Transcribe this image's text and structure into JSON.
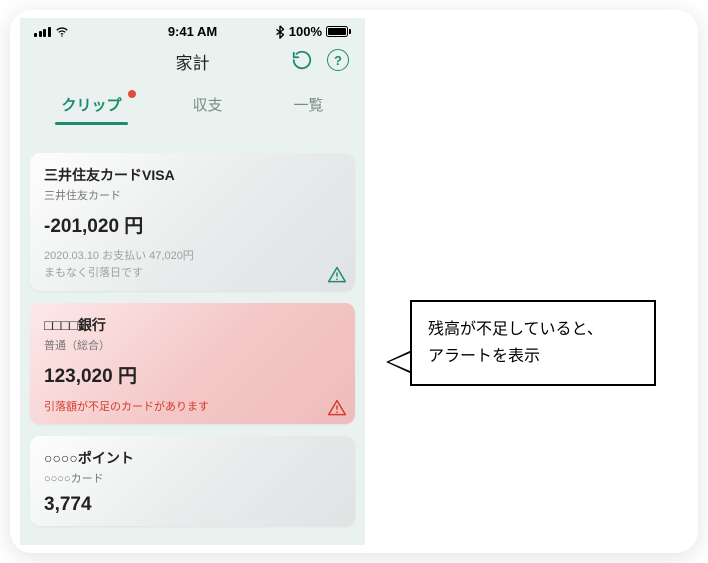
{
  "statusbar": {
    "time": "9:41 AM",
    "bluetooth_icon": "bluetooth",
    "battery_pct": "100%"
  },
  "header": {
    "title": "家計",
    "refresh_icon": "refresh",
    "help_icon": "help",
    "help_glyph": "?"
  },
  "tabs": [
    {
      "label": "クリップ",
      "active": true,
      "has_dot": true
    },
    {
      "label": "収支",
      "active": false,
      "has_dot": false
    },
    {
      "label": "一覧",
      "active": false,
      "has_dot": false
    }
  ],
  "cards": [
    {
      "title": "三井住友カードVISA",
      "subtitle": "三井住友カード",
      "amount": "-201,020 円",
      "note_line1": "2020.03.10 お支払い 47,020円",
      "note_line2": "まもなく引落日です",
      "status": "warn-green"
    },
    {
      "title": "□□□□銀行",
      "subtitle": "普通（総合）",
      "amount": "123,020 円",
      "warn": "引落額が不足のカードがあります",
      "status": "alert-red"
    },
    {
      "title": "○○○○ポイント",
      "subtitle": "○○○○カード",
      "amount": "3,774",
      "status": "none"
    }
  ],
  "more_label": "•••",
  "callout": {
    "line1": "残高が不足していると、",
    "line2": "アラートを表示"
  },
  "colors": {
    "accent": "#1f8a70",
    "alert": "#d43b2e"
  }
}
